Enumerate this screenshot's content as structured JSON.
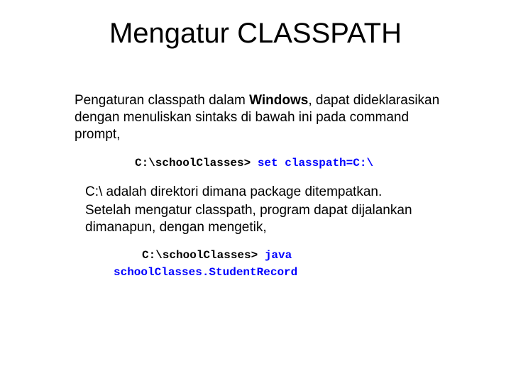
{
  "title": "Mengatur CLASSPATH",
  "para1_pre": "Pengaturan classpath dalam ",
  "para1_bold": "Windows",
  "para1_post": ", dapat dideklarasikan dengan menuliskan sintaks di bawah ini pada command prompt,",
  "code1_black": "C:\\schoolClasses> ",
  "code1_blue": "set classpath=C:\\",
  "para2_line1": "C:\\ adalah direktori dimana package ditempatkan.",
  "para2_line2": "Setelah mengatur classpath, program dapat dijalankan dimanapun, dengan mengetik,",
  "code2_black": "C:\\schoolClasses> ",
  "code2_blue": "java",
  "code3_blue": "schoolClasses.StudentRecord"
}
